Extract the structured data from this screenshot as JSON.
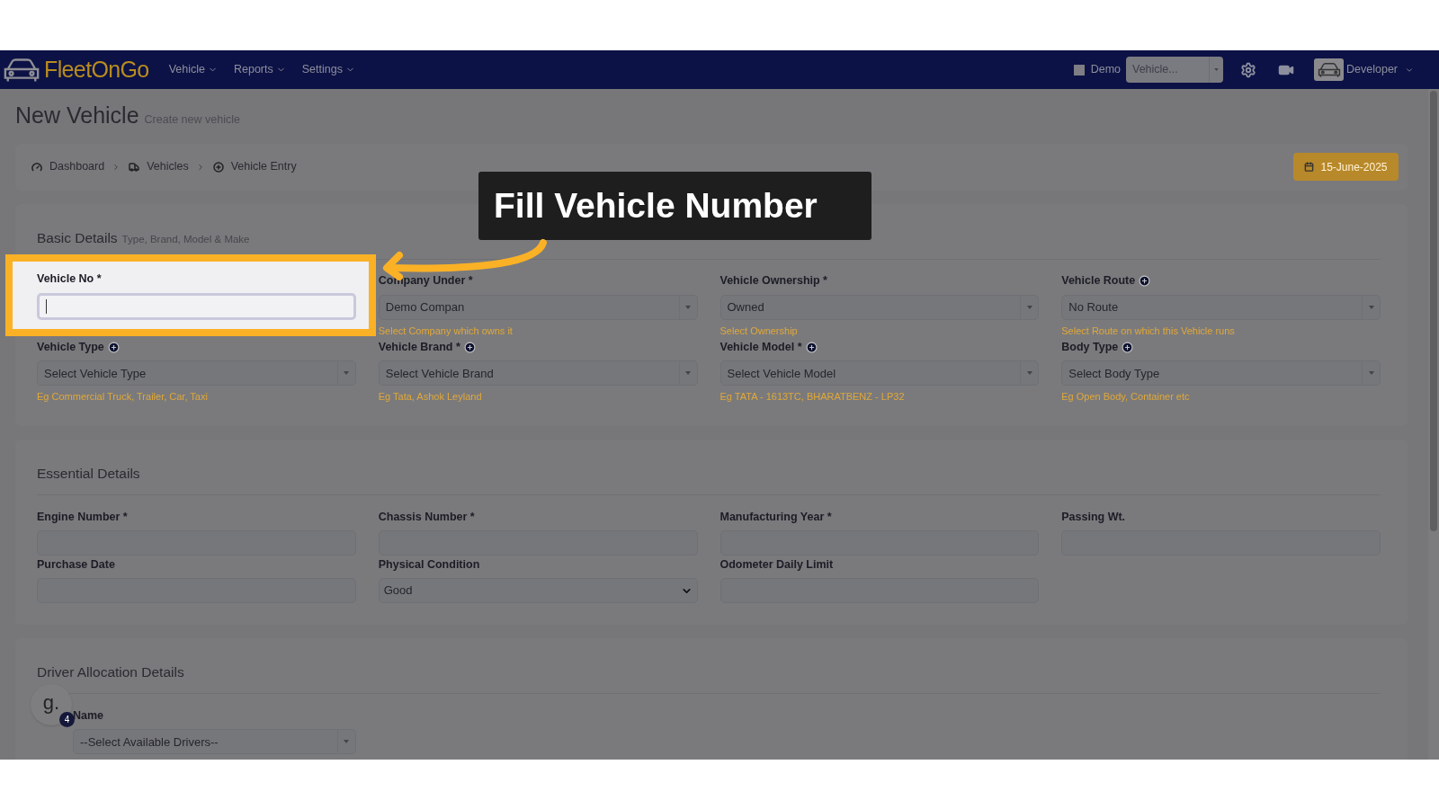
{
  "navbar": {
    "logo": "FleetOnGo",
    "menus": [
      {
        "label": "Vehicle"
      },
      {
        "label": "Reports"
      },
      {
        "label": "Settings"
      }
    ],
    "demo": {
      "label": "Demo",
      "checked": false
    },
    "vehicle_select": {
      "value": "Vehicle..."
    },
    "user": "Developer"
  },
  "page": {
    "title": "New Vehicle",
    "subtitle": "Create new vehicle"
  },
  "breadcrumb": [
    {
      "label": "Dashboard"
    },
    {
      "label": "Vehicles"
    },
    {
      "label": "Vehicle Entry"
    }
  ],
  "date": "15-June-2025",
  "callout": "Fill Vehicle Number",
  "sections": [
    {
      "title": "Basic Details",
      "subtitle": "Type, Brand, Model & Make",
      "fields": [
        {
          "label": "Vehicle No *",
          "kind": "text",
          "highlighted": true
        },
        {
          "label": "Company Under *",
          "kind": "select",
          "value": "Demo Compan",
          "hint": "Select Company which owns it"
        },
        {
          "label": "Vehicle Ownership *",
          "kind": "select",
          "value": "Owned",
          "hint": "Select Ownership"
        },
        {
          "label": "Vehicle Route",
          "kind": "select",
          "value": "No Route",
          "hint": "Select Route on which this Vehicle runs",
          "add": true
        },
        {
          "label": "Vehicle Type",
          "kind": "select",
          "value": "Select Vehicle Type",
          "hint": "Eg Commercial Truck, Trailer, Car, Taxi",
          "add": true
        },
        {
          "label": "Vehicle Brand *",
          "kind": "select",
          "value": "Select Vehicle Brand",
          "hint": "Eg Tata, Ashok Leyland",
          "add": true
        },
        {
          "label": "Vehicle Model *",
          "kind": "select",
          "value": "Select Vehicle Model",
          "hint": "Eg TATA - 1613TC, BHARATBENZ - LP32",
          "add": true
        },
        {
          "label": "Body Type",
          "kind": "select",
          "value": "Select Body Type",
          "hint": "Eg Open Body, Container etc",
          "add": true
        }
      ]
    },
    {
      "title": "Essential Details",
      "fields": [
        {
          "label": "Engine Number *",
          "kind": "text"
        },
        {
          "label": "Chassis Number *",
          "kind": "text"
        },
        {
          "label": "Manufacturing Year *",
          "kind": "text"
        },
        {
          "label": "Passing Wt.",
          "kind": "text"
        },
        {
          "label": "Purchase Date",
          "kind": "text"
        },
        {
          "label": "Physical Condition",
          "kind": "dropdown",
          "value": "Good"
        },
        {
          "label": "Odometer Daily Limit",
          "kind": "text"
        }
      ]
    },
    {
      "title": "Driver Allocation Details",
      "fields": [
        {
          "label": "Name",
          "kind": "select",
          "value": "--Select Available Drivers--"
        }
      ]
    }
  ],
  "helper": {
    "letter": "g.",
    "count": "4"
  }
}
